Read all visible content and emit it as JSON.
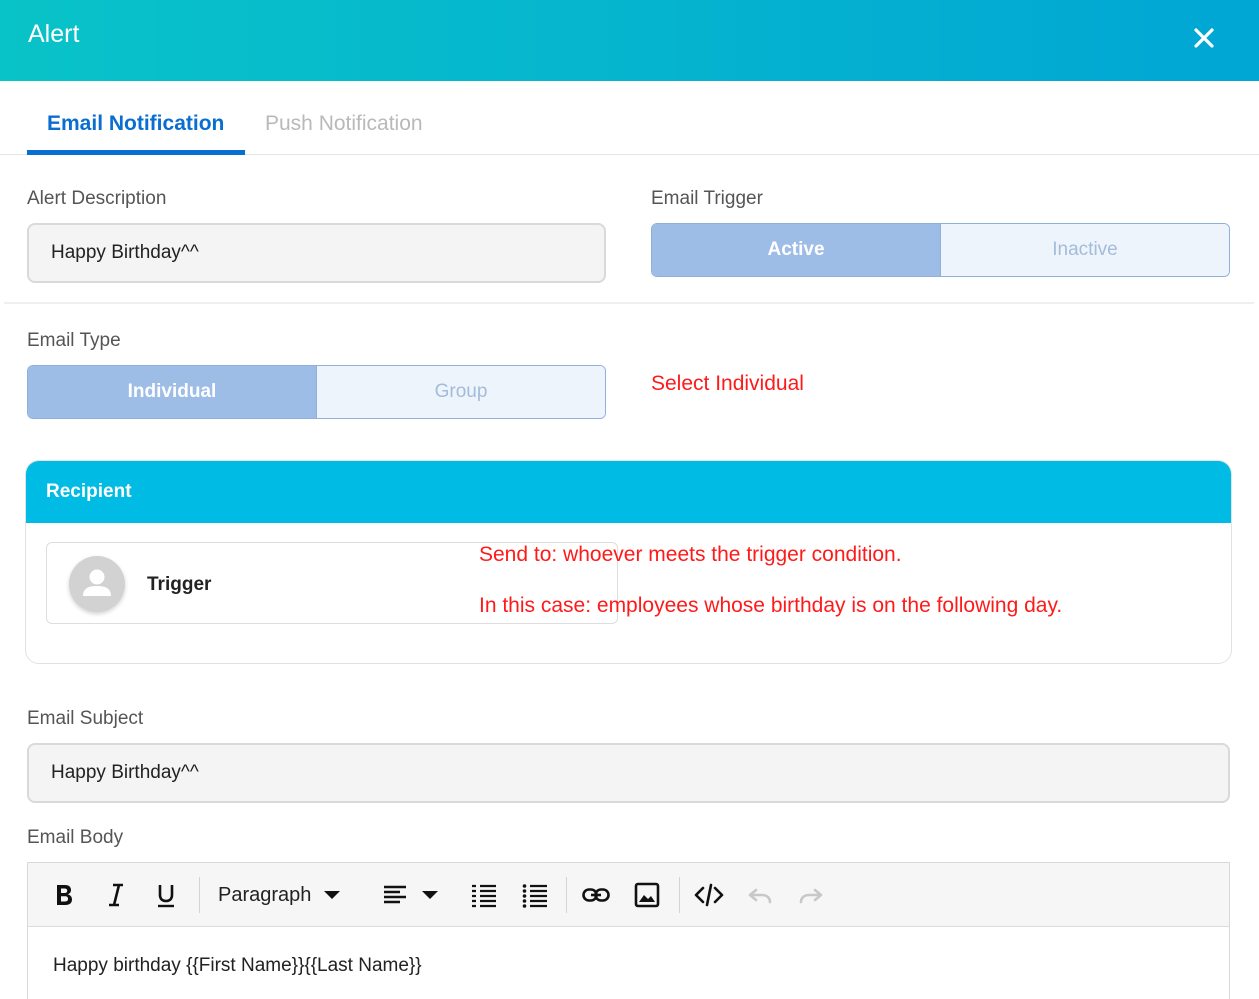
{
  "header": {
    "title": "Alert"
  },
  "tabs": [
    {
      "label": "Email Notification",
      "active": true
    },
    {
      "label": "Push Notification",
      "active": false
    }
  ],
  "alert_description": {
    "label": "Alert Description",
    "value": "Happy Birthday^^"
  },
  "email_trigger": {
    "label": "Email Trigger",
    "options": [
      "Active",
      "Inactive"
    ],
    "selected": "Active"
  },
  "email_type": {
    "label": "Email Type",
    "options": [
      "Individual",
      "Group"
    ],
    "selected": "Individual"
  },
  "annotations": {
    "select_individual": "Select Individual",
    "send_to": "Send to: whoever meets the trigger condition.",
    "in_this_case": "In this case: employees whose birthday is on the following day."
  },
  "recipient": {
    "title": "Recipient",
    "item_label": "Trigger"
  },
  "email_subject": {
    "label": "Email Subject",
    "value": "Happy Birthday^^"
  },
  "email_body": {
    "label": "Email Body",
    "block_format": "Paragraph",
    "content": "Happy birthday {{First Name}}{{Last Name}}",
    "toolbar_icons": [
      "bold-icon",
      "italic-icon",
      "underline-icon",
      "align-left-icon",
      "numbered-list-icon",
      "bullet-list-icon",
      "link-icon",
      "image-icon",
      "code-icon",
      "undo-icon",
      "redo-icon"
    ]
  },
  "colors": {
    "header_gradient_start": "#08c3c8",
    "header_gradient_end": "#00a6d4",
    "tab_active": "#0a6ed1",
    "toggle_selected": "#9dbde7",
    "recipient_header": "#00bbe3",
    "annotation": "#ff1a1a"
  }
}
